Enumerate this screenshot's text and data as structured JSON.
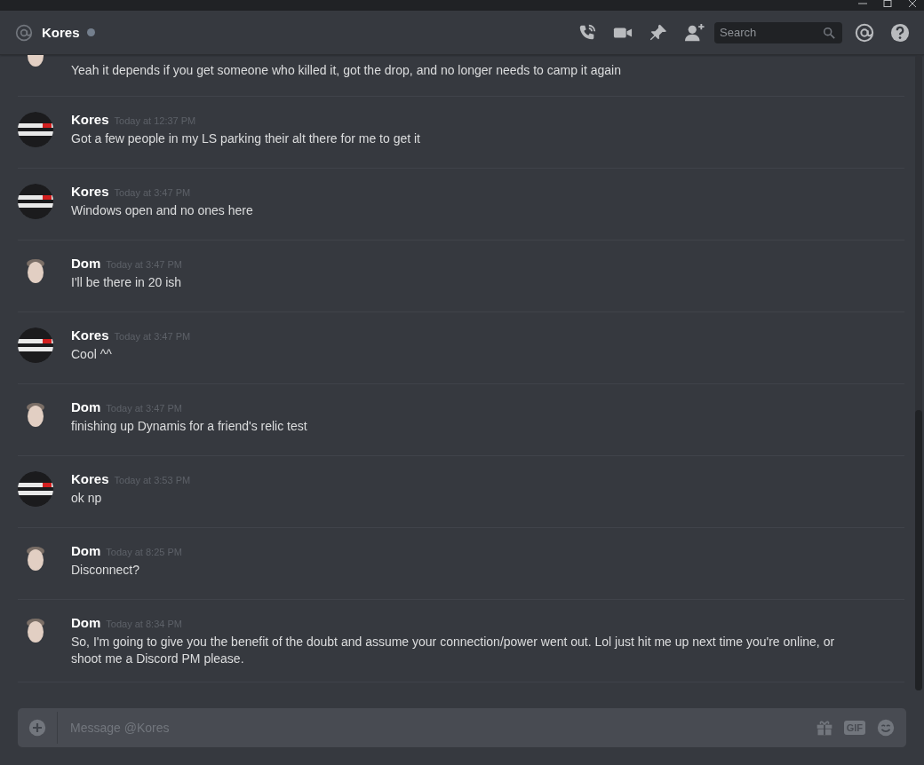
{
  "header": {
    "channel": "Kores",
    "online": false,
    "search": {
      "placeholder": "Search"
    }
  },
  "messages": [
    {
      "kind": "continued",
      "avatar": {
        "kind": "person"
      },
      "text": "Yeah it depends if you get someone who killed it, got the drop, and no longer needs to camp it again"
    },
    {
      "kind": "full",
      "avatar": {
        "kind": "logo"
      },
      "author": "Kores",
      "time": "Today at 12:37 PM",
      "text": "Got a few people in my LS parking their alt there for me to get it"
    },
    {
      "kind": "full",
      "avatar": {
        "kind": "logo"
      },
      "author": "Kores",
      "time": "Today at 3:47 PM",
      "text": "Windows open and no ones here"
    },
    {
      "kind": "full",
      "avatar": {
        "kind": "person"
      },
      "author": "Dom",
      "time": "Today at 3:47 PM",
      "text": "I'll be there in 20 ish"
    },
    {
      "kind": "full",
      "avatar": {
        "kind": "logo"
      },
      "author": "Kores",
      "time": "Today at 3:47 PM",
      "text": "Cool ^^"
    },
    {
      "kind": "full",
      "avatar": {
        "kind": "person"
      },
      "author": "Dom",
      "time": "Today at 3:47 PM",
      "text": "finishing up Dynamis for a friend's relic test"
    },
    {
      "kind": "full",
      "avatar": {
        "kind": "logo"
      },
      "author": "Kores",
      "time": "Today at 3:53 PM",
      "text": "ok np"
    },
    {
      "kind": "full",
      "avatar": {
        "kind": "person"
      },
      "author": "Dom",
      "time": "Today at 8:25 PM",
      "text": "Disconnect?"
    },
    {
      "kind": "full",
      "avatar": {
        "kind": "person"
      },
      "author": "Dom",
      "time": "Today at 8:34 PM",
      "text": "So, I'm going to give you the benefit of the doubt and assume your connection/power went out. Lol just hit me up next time you're online, or shoot me a Discord PM please."
    }
  ],
  "composer": {
    "placeholder": "Message @Kores",
    "gif_label": "GIF"
  }
}
